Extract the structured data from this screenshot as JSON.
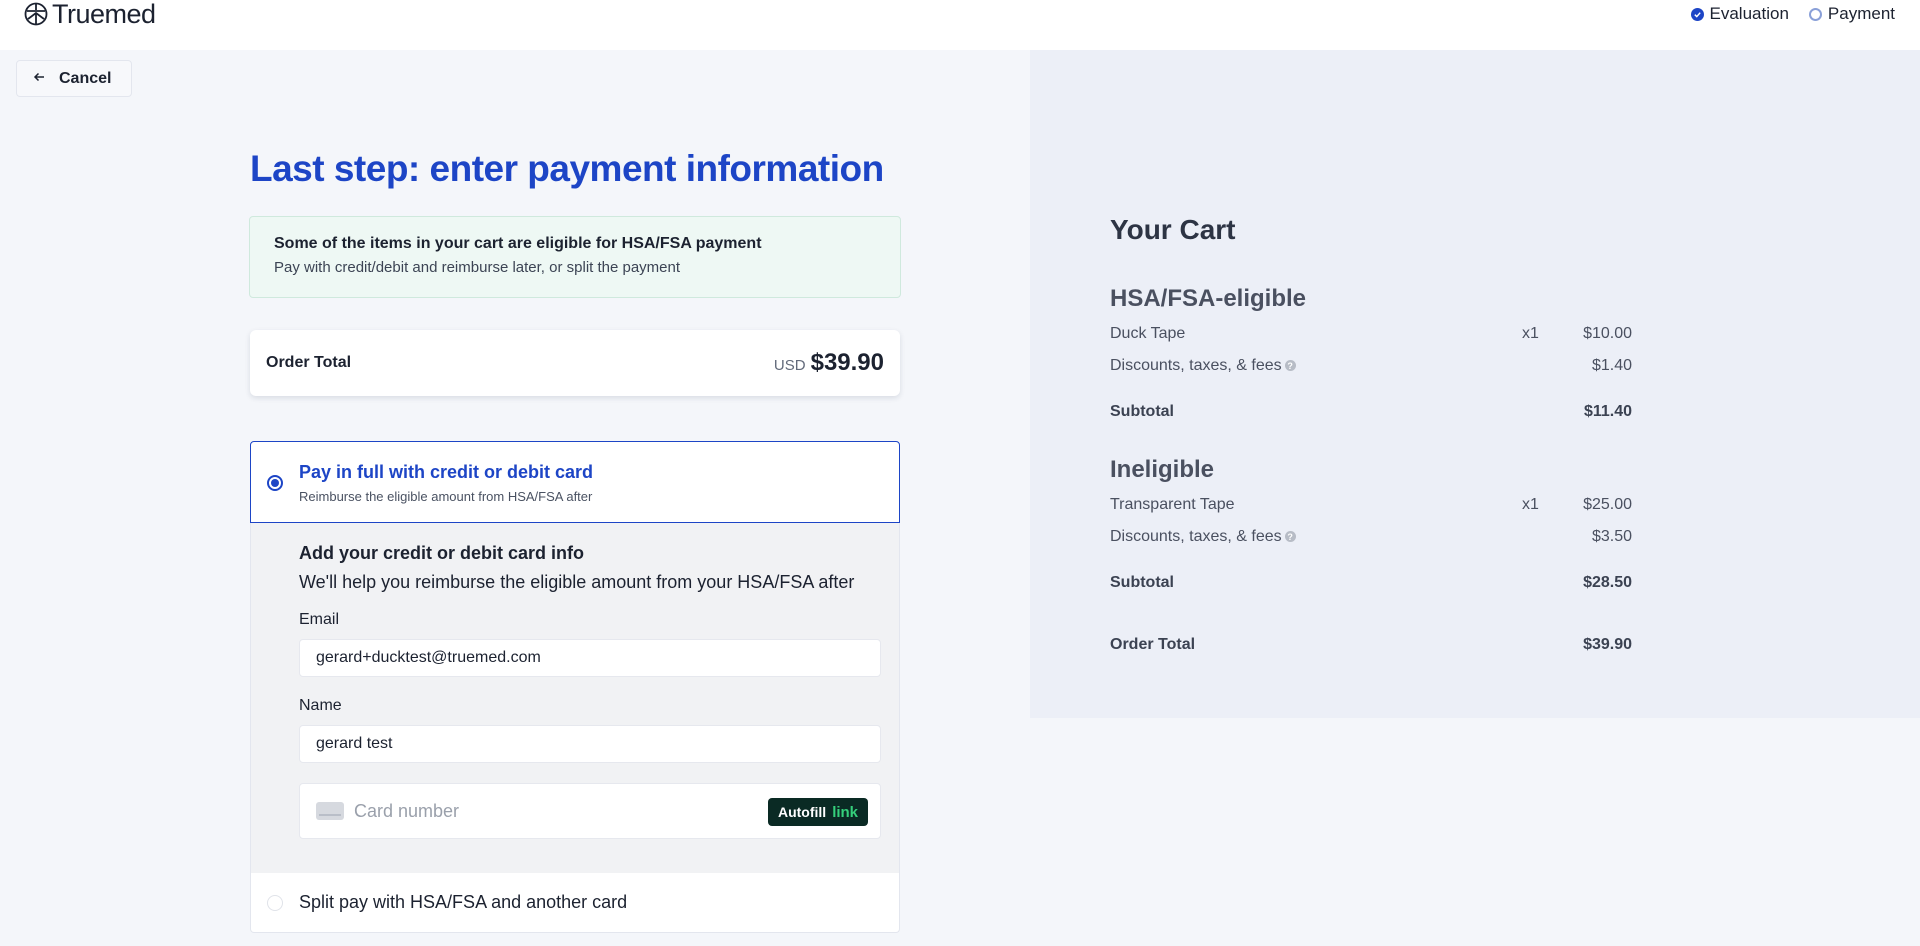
{
  "header": {
    "logo_text": "Truemed",
    "steps": [
      {
        "label": "Evaluation",
        "status": "done"
      },
      {
        "label": "Payment",
        "status": "current"
      }
    ]
  },
  "cancel": {
    "label": "Cancel"
  },
  "main": {
    "title": "Last step: enter payment information",
    "eligible_banner": {
      "title": "Some of the items in your cart are eligible for HSA/FSA payment",
      "subtitle": "Pay with credit/debit and reimburse later, or split the payment"
    },
    "order_total": {
      "label": "Order Total",
      "currency": "USD",
      "amount": "$39.90"
    },
    "payment_options": [
      {
        "title": "Pay in full with credit or debit card",
        "subtitle": "Reimburse the eligible amount from HSA/FSA after",
        "selected": true
      },
      {
        "title": "Split pay with HSA/FSA and another card",
        "selected": false
      }
    ],
    "card_form": {
      "title": "Add your credit or debit card info",
      "subtitle": "We'll help you reimburse the eligible amount from your HSA/FSA after",
      "email_label": "Email",
      "email_value": "gerard+ducktest@truemed.com",
      "name_label": "Name",
      "name_value": "gerard test",
      "card_placeholder": "Card number",
      "autofill_label": "Autofill",
      "autofill_link": "link"
    }
  },
  "cart": {
    "title": "Your Cart",
    "sections": [
      {
        "title": "HSA/FSA-eligible",
        "items": [
          {
            "name": "Duck Tape",
            "qty": "x1",
            "price": "$10.00"
          }
        ],
        "fees_label": "Discounts, taxes, & fees",
        "fees": "$1.40",
        "subtotal_label": "Subtotal",
        "subtotal": "$11.40"
      },
      {
        "title": "Ineligible",
        "items": [
          {
            "name": "Transparent Tape",
            "qty": "x1",
            "price": "$25.00"
          }
        ],
        "fees_label": "Discounts, taxes, & fees",
        "fees": "$3.50",
        "subtotal_label": "Subtotal",
        "subtotal": "$28.50"
      }
    ],
    "order_total_label": "Order Total",
    "order_total": "$39.90"
  },
  "colors": {
    "brand_blue": "#1d45c6",
    "banner_green_bg": "#eef8f4",
    "link_green": "#35d07b",
    "autofill_bg": "#0a2a24"
  },
  "icons": [
    "truemed-logo-icon",
    "check-icon",
    "arrow-left-icon",
    "card-icon",
    "info-icon"
  ]
}
